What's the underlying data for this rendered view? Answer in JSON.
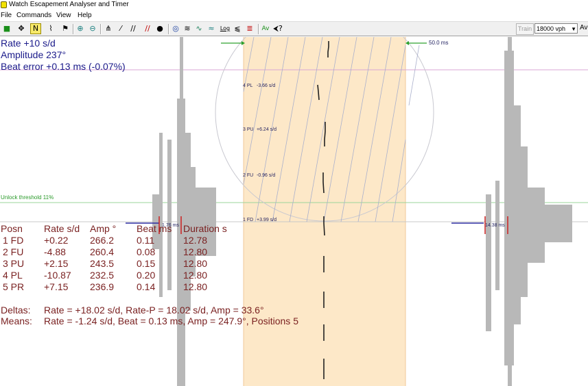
{
  "window": {
    "title": "Watch Escapement Analyser and Timer"
  },
  "menu": [
    "File",
    "Commands",
    "View",
    "Help"
  ],
  "toolbar": {
    "icons": [
      "green-box-icon",
      "move-icon",
      "select-icon",
      "trace-icon",
      "flag-icon",
      "zoom-in-icon",
      "zoom-out-icon",
      "marker-icon",
      "slash-icon",
      "double-slash-icon",
      "red-slash-icon",
      "drop-icon",
      "globe-icon",
      "waves-icon",
      "wave-trace-icon",
      "log-icon",
      "histogram-icon",
      "chart-icon",
      "average-icon",
      "help-pointer-icon"
    ],
    "log_label": "Log",
    "train_label": "Train",
    "vph_value": "18000 vph",
    "av_label": "Av"
  },
  "readout": {
    "rate": "Rate    +10 s/d",
    "amplitude": "Amplitude 237°",
    "beat_error": "Beat error +0.13 ms (-0.07%)"
  },
  "trace": {
    "unlock_threshold": "Unlock threshold 11%",
    "window_ms": "50.0 ms",
    "left_ms": "1.76 ms",
    "right_ms": "14.38 ms",
    "positions": [
      {
        "label": "4 PL",
        "rate": "-3.66 s/d"
      },
      {
        "label": "3 PU",
        "rate": "+6.24 s/d"
      },
      {
        "label": "2 FU",
        "rate": "-0.96 s/d"
      },
      {
        "label": "1 FD",
        "rate": "+3.99 s/d"
      }
    ]
  },
  "table": {
    "headers": [
      "Posn",
      "Rate s/d",
      "Amp °",
      "Beat ms",
      "Duration s"
    ],
    "rows": [
      [
        "1 FD",
        "+0.22",
        "266.2",
        "0.11",
        "12.78"
      ],
      [
        "2 FU",
        "-4.88",
        "260.4",
        "0.08",
        "12.80"
      ],
      [
        "3 PU",
        "+2.15",
        "243.5",
        "0.15",
        "12.80"
      ],
      [
        "4 PL",
        "-10.87",
        "232.5",
        "0.20",
        "12.80"
      ],
      [
        "5 PR",
        "+7.15",
        "236.9",
        "0.14",
        "12.80"
      ]
    ]
  },
  "summary": {
    "deltas_label": "Deltas:",
    "deltas_value": "Rate = +18.02 s/d, Rate-P = 18.02 s/d, Amp =  33.6°",
    "means_label": "Means:",
    "means_value": "Rate = -1.24 s/d, Beat = 0.13 ms, Amp = 247.9°, Positions 5"
  },
  "colors": {
    "band": "#fde8c8",
    "threshold": "#9ad59a",
    "pink_line": "#d9a6d4",
    "readout_text": "#1a1a8a",
    "table_text": "#7a2121",
    "waveform": "#b8b8b8"
  }
}
